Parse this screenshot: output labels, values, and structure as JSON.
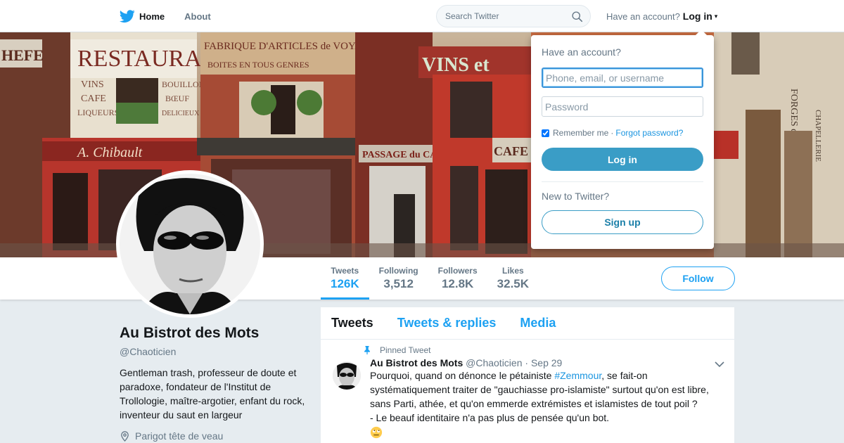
{
  "nav": {
    "logo_icon": "twitter-bird-icon",
    "home_label": "Home",
    "about_label": "About",
    "search_placeholder": "Search Twitter",
    "account_prompt": "Have an account?",
    "login_label": "Log in",
    "caret": "▾"
  },
  "banner": {
    "signs": [
      "RESTAURANT",
      "VINS",
      "CAFE",
      "LIQUEURS",
      "BOUILLON",
      "BŒUF",
      "DELICIEUX",
      "FABRIQUE D'ARTICLES de VOYAGE",
      "BOITES EN TOUS GENRES",
      "VINS et",
      "A. Chibault",
      "PASSAGE du CAIRE",
      "CAFE",
      "FORGES de PARIS",
      "CHAPELLERIE"
    ]
  },
  "profile": {
    "name": "Au Bistrot des Mots",
    "handle": "@Chaoticien",
    "bio": "Gentleman trash, professeur de doute et paradoxe, fondateur de l'Institut de Trollologie, maître-argotier, enfant du rock, inventeur du saut en largeur",
    "location": "Parigot tête de veau"
  },
  "stats": [
    {
      "label": "Tweets",
      "value": "126K"
    },
    {
      "label": "Following",
      "value": "3,512"
    },
    {
      "label": "Followers",
      "value": "12.8K"
    },
    {
      "label": "Likes",
      "value": "32.5K"
    }
  ],
  "follow_label": "Follow",
  "timeline": {
    "tabs": [
      "Tweets",
      "Tweets & replies",
      "Media"
    ],
    "pinned_label": "Pinned Tweet",
    "tweet": {
      "name": "Au Bistrot des Mots",
      "handle": "@Chaoticien",
      "separator": "·",
      "date": "Sep 29",
      "text_before": "Pourquoi, quand on dénonce le pétainiste ",
      "hashtag": "#Zemmour",
      "text_after": ", se fait-on systématiquement traiter de \"gauchiasse pro-islamiste\" surtout qu'on est libre, sans Parti, athée, et qu'on emmerde extrémistes et islamistes de tout poil ?",
      "line2": "- Le beauf identitaire n'a pas plus de pensée qu'un bot.",
      "emoji": "eye-roll-emoji"
    }
  },
  "login_dropdown": {
    "title": "Have an account?",
    "username_placeholder": "Phone, email, or username",
    "password_placeholder": "Password",
    "remember_label": "Remember me",
    "separator": "·",
    "forgot_label": "Forgot password?",
    "login_button": "Log in",
    "new_prompt": "New to Twitter?",
    "signup_button": "Sign up"
  },
  "colors": {
    "accent": "#1da1f2",
    "login_button": "#3a9dc6",
    "background": "#e6ecf0"
  }
}
